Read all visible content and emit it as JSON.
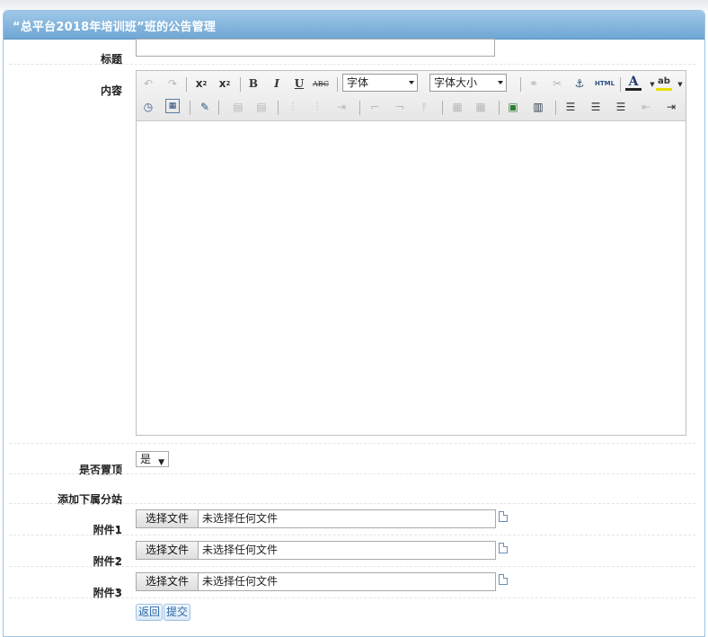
{
  "header": {
    "title": "“总平台2018年培训班”班的公告管理"
  },
  "form": {
    "title_label": "标题",
    "content_label": "内容",
    "pin_label": "是否置顶",
    "pin_value": "是",
    "subsite_label": "添加下属分站",
    "attach1_label": "附件1",
    "attach2_label": "附件2",
    "attach3_label": "附件3",
    "colon": "："
  },
  "editor": {
    "font_select": "字体",
    "size_select": "字体大小",
    "bold": "B",
    "italic": "I",
    "underline": "U",
    "strike": "ABC",
    "html_source": "HTML",
    "font_color": "A",
    "highlight": "ab"
  },
  "file": {
    "button_label": "选择文件",
    "no_file_text": "未选择任何文件"
  },
  "actions": {
    "back_label": "返回",
    "submit_label": "提交"
  }
}
